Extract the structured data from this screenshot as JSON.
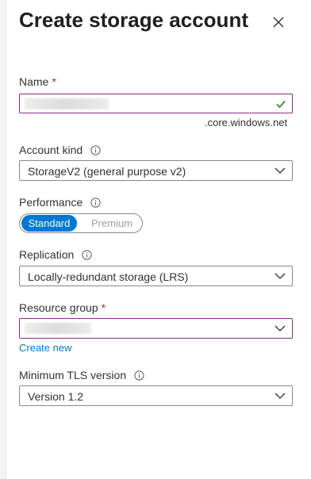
{
  "panel": {
    "title": "Create storage account"
  },
  "name_field": {
    "label": "Name",
    "required_mark": "*",
    "value": "",
    "suffix": ".core.windows.net"
  },
  "account_kind": {
    "label": "Account kind",
    "selected": "StorageV2 (general purpose v2)"
  },
  "performance": {
    "label": "Performance",
    "options": [
      "Standard",
      "Premium"
    ],
    "selected": "Standard"
  },
  "replication": {
    "label": "Replication",
    "selected": "Locally-redundant storage (LRS)"
  },
  "resource_group": {
    "label": "Resource group",
    "required_mark": "*",
    "value": "",
    "create_new_link": "Create new"
  },
  "tls": {
    "label": "Minimum TLS version",
    "selected": "Version 1.2"
  },
  "colors": {
    "accent": "#0078d4",
    "required": "#a4262c",
    "focus_border": "#8a2a8a",
    "valid_check": "#107c10"
  },
  "icons": {
    "close": "close-icon",
    "info": "info-icon",
    "check": "checkmark-icon",
    "chevron": "chevron-down-icon"
  }
}
